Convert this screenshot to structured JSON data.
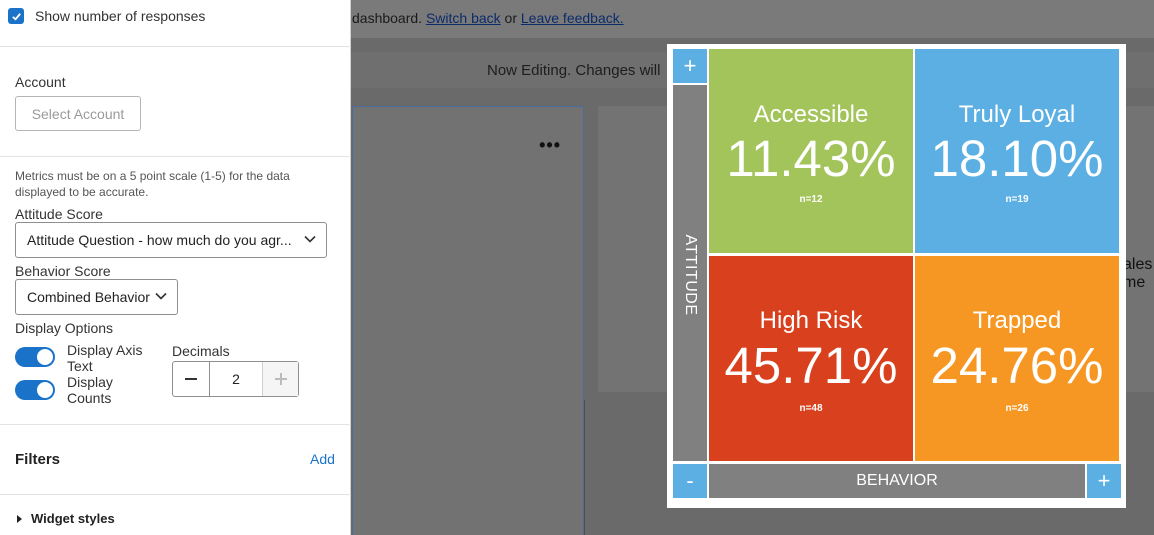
{
  "background": {
    "banner_message": "dashboard.",
    "switch_back": "Switch back",
    "or": "or",
    "leave_feedback": "Leave feedback.",
    "editing_banner": "Now Editing. Changes will",
    "card_dots": "•••",
    "card2_text_line1": "ales",
    "card2_text_line2": "me"
  },
  "panel": {
    "show_responses_label": "Show number of responses",
    "show_responses_checked": true,
    "account_label": "Account",
    "account_placeholder": "Select Account",
    "metrics_note": "Metrics must be on a 5 point scale (1-5) for the data displayed to be accurate.",
    "attitude_label": "Attitude Score",
    "attitude_value": "Attitude Question - how much do you agr...",
    "behavior_label": "Behavior Score",
    "behavior_value": "Combined Behavior",
    "display_options_label": "Display Options",
    "display_axis_text_label": "Display Axis Text",
    "display_counts_label": "Display Counts",
    "decimals_label": "Decimals",
    "decimals_value": "2",
    "filters_title": "Filters",
    "filters_add": "Add",
    "widget_styles_label": "Widget styles"
  },
  "quadrant": {
    "y_axis_label": "ATTITUDE",
    "x_axis_label": "BEHAVIOR",
    "plus_top": "+",
    "minus_bottom": "-",
    "plus_right": "+",
    "cells": [
      {
        "name": "Accessible",
        "percent": "11.43%",
        "n": "n=12",
        "color": "#a3c45a"
      },
      {
        "name": "Truly Loyal",
        "percent": "18.10%",
        "n": "n=19",
        "color": "#5bafe3"
      },
      {
        "name": "High Risk",
        "percent": "45.71%",
        "n": "n=48",
        "color": "#d9411e"
      },
      {
        "name": "Trapped",
        "percent": "24.76%",
        "n": "n=26",
        "color": "#f59722"
      }
    ]
  }
}
